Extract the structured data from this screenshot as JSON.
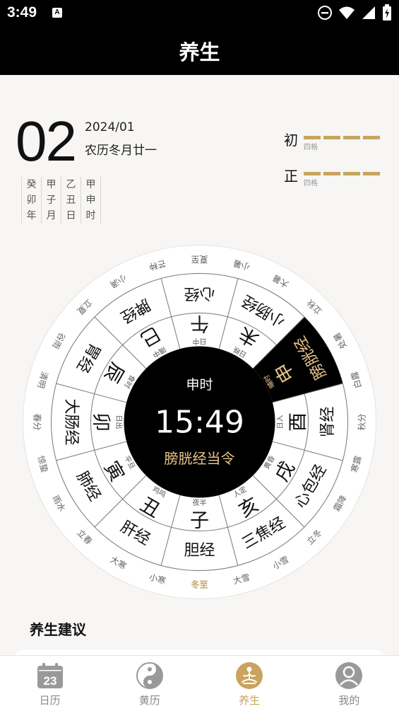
{
  "status_bar": {
    "time": "3:49",
    "sim_icon": "A"
  },
  "header": {
    "title": "养生"
  },
  "date": {
    "day": "02",
    "year_month": "2024/01",
    "lunar": "农历冬月廿一",
    "ganzhi": [
      [
        "癸",
        "卯",
        "年"
      ],
      [
        "甲",
        "子",
        "月"
      ],
      [
        "乙",
        "丑",
        "日"
      ],
      [
        "甲",
        "申",
        "时"
      ]
    ]
  },
  "moon_phase": [
    {
      "char": "初",
      "sub": "四格",
      "bars": 4
    },
    {
      "char": "正",
      "sub": "四格",
      "bars": 4
    }
  ],
  "wheel": {
    "center_title": "申时",
    "center_time": "15:49",
    "center_status": "膀胱经当令",
    "active_index": 8,
    "hours": [
      {
        "branch": "子",
        "period": "夜半",
        "meridian": "胆经"
      },
      {
        "branch": "丑",
        "period": "鸡鸣",
        "meridian": "肝经"
      },
      {
        "branch": "寅",
        "period": "平旦",
        "meridian": "肺经"
      },
      {
        "branch": "卯",
        "period": "日出",
        "meridian": "大肠经"
      },
      {
        "branch": "辰",
        "period": "食时",
        "meridian": "胃经"
      },
      {
        "branch": "巳",
        "period": "隅中",
        "meridian": "脾经"
      },
      {
        "branch": "午",
        "period": "日中",
        "meridian": "心经"
      },
      {
        "branch": "未",
        "period": "日昳",
        "meridian": "小肠经"
      },
      {
        "branch": "申",
        "period": "晡时",
        "meridian": "膀胱经"
      },
      {
        "branch": "酉",
        "period": "日入",
        "meridian": "肾经"
      },
      {
        "branch": "戌",
        "period": "黄昏",
        "meridian": "心包经"
      },
      {
        "branch": "亥",
        "period": "人定",
        "meridian": "三焦经"
      }
    ],
    "solar_terms": [
      "冬至",
      "小寒",
      "大寒",
      "立春",
      "雨水",
      "惊蛰",
      "春分",
      "清明",
      "谷雨",
      "立夏",
      "小满",
      "芒种",
      "夏至",
      "小暑",
      "大暑",
      "立秋",
      "处暑",
      "白露",
      "秋分",
      "寒露",
      "霜降",
      "立冬",
      "小雪",
      "大雪"
    ],
    "current_term": "冬至"
  },
  "advice": {
    "title": "养生建议"
  },
  "tabs": [
    {
      "label": "日历",
      "icon": "calendar-icon",
      "badge": "23"
    },
    {
      "label": "黄历",
      "icon": "yin-yang-icon"
    },
    {
      "label": "养生",
      "icon": "meditation-icon"
    },
    {
      "label": "我的",
      "icon": "user-icon"
    }
  ],
  "active_tab": 2,
  "colors": {
    "accent": "#c9a45f",
    "dark": "#000000",
    "highlight_text": "#e8c48a",
    "background": "#f7f6f4"
  }
}
